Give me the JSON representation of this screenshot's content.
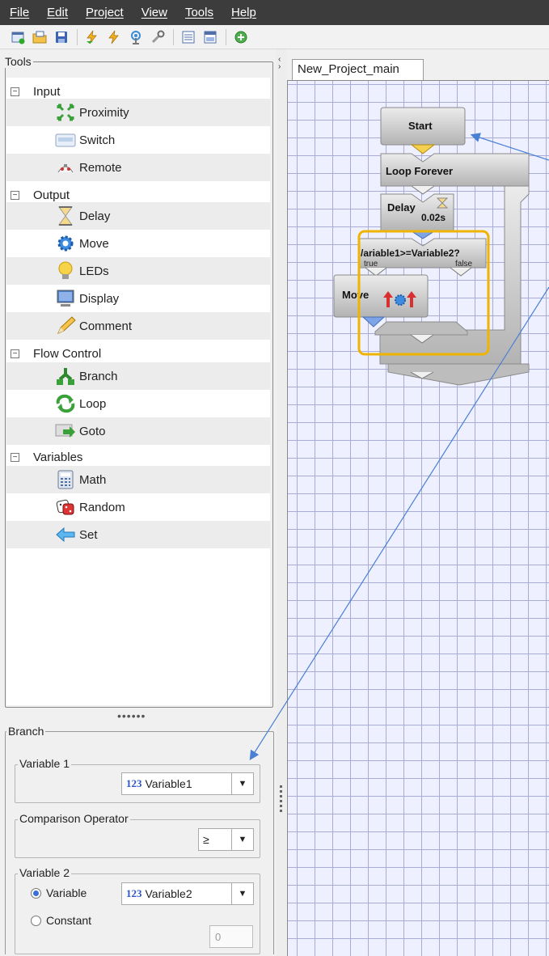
{
  "menu": [
    "File",
    "Edit",
    "Project",
    "View",
    "Tools",
    "Help"
  ],
  "tools_panel": {
    "title": "Tools",
    "categories": [
      {
        "label": "Input",
        "items": [
          {
            "label": "Proximity",
            "icon": "proximity-icon"
          },
          {
            "label": "Switch",
            "icon": "switch-icon"
          },
          {
            "label": "Remote",
            "icon": "remote-icon"
          }
        ]
      },
      {
        "label": "Output",
        "items": [
          {
            "label": "Delay",
            "icon": "hourglass-icon"
          },
          {
            "label": "Move",
            "icon": "gear-icon"
          },
          {
            "label": "LEDs",
            "icon": "lightbulb-icon"
          },
          {
            "label": "Display",
            "icon": "monitor-icon"
          },
          {
            "label": "Comment",
            "icon": "pencil-icon"
          }
        ]
      },
      {
        "label": "Flow Control",
        "items": [
          {
            "label": "Branch",
            "icon": "branch-icon"
          },
          {
            "label": "Loop",
            "icon": "loop-icon"
          },
          {
            "label": "Goto",
            "icon": "goto-icon"
          }
        ]
      },
      {
        "label": "Variables",
        "items": [
          {
            "label": "Math",
            "icon": "calculator-icon"
          },
          {
            "label": "Random",
            "icon": "dice-icon"
          },
          {
            "label": "Set",
            "icon": "arrow-left-icon"
          }
        ]
      }
    ]
  },
  "branch_panel": {
    "title": "Branch",
    "variable1": {
      "legend": "Variable 1",
      "value": "Variable1",
      "type_tag": "123"
    },
    "operator": {
      "legend": "Comparison Operator",
      "value": "≥"
    },
    "variable2": {
      "legend": "Variable 2",
      "radio_variable": "Variable",
      "radio_constant": "Constant",
      "value": "Variable2",
      "type_tag": "123",
      "constant_value": "0",
      "selected": "Variable"
    }
  },
  "canvas": {
    "tab": "New_Project_main",
    "blocks": {
      "start": "Start",
      "loop": "Loop Forever",
      "delay": "Delay",
      "delay_value": "0.02s",
      "branch": "/ariable1>=Variable2?",
      "branch_true": "true",
      "branch_false": "false",
      "move": "Move"
    }
  },
  "colors": {
    "selection": "#f0b400",
    "arrow": "#4a7fd6",
    "grid": "#a8acd6",
    "canvas_bg": "#eef0ff"
  }
}
